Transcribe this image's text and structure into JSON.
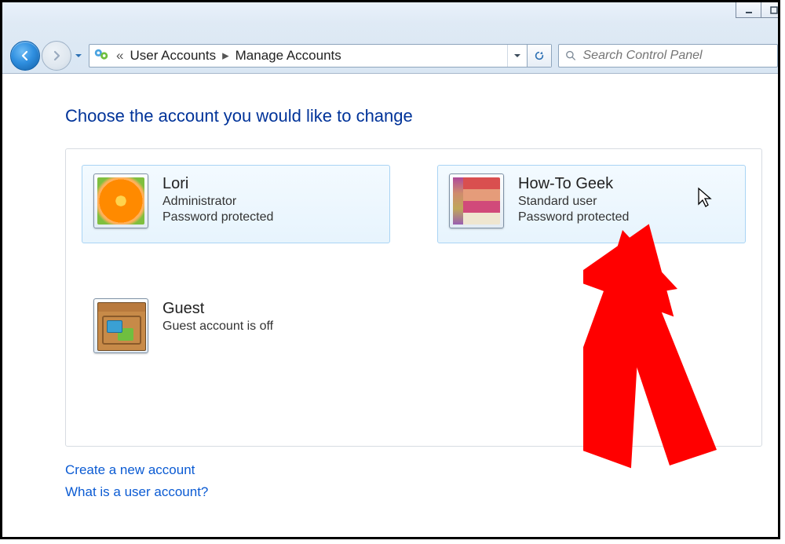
{
  "breadcrumb": {
    "root_label": "User Accounts",
    "current_label": "Manage Accounts"
  },
  "search": {
    "placeholder": "Search Control Panel"
  },
  "page": {
    "title": "Choose the account you would like to change"
  },
  "accounts": [
    {
      "name": "Lori",
      "role": "Administrator",
      "status": "Password protected",
      "avatar": "flower",
      "highlighted": true
    },
    {
      "name": "How-To Geek",
      "role": "Standard user",
      "status": "Password protected",
      "avatar": "quilt",
      "highlighted": true
    },
    {
      "name": "Guest",
      "role": "Guest account is off",
      "status": "",
      "avatar": "suitcase",
      "highlighted": false
    }
  ],
  "links": {
    "create": "Create a new account",
    "what_is": "What is a user account?"
  }
}
